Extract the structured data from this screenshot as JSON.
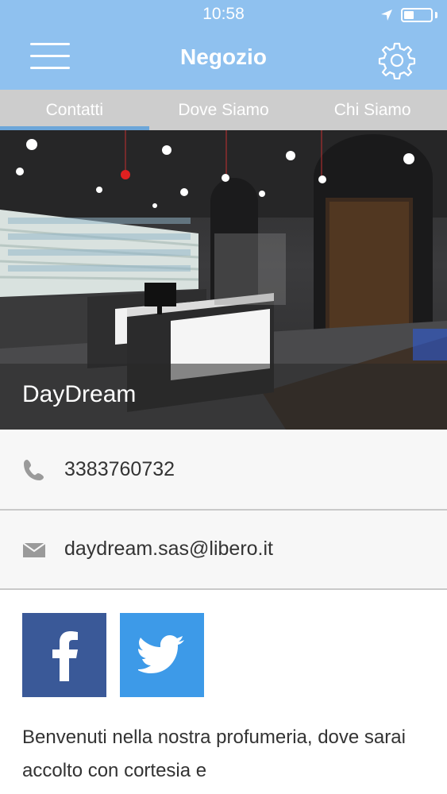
{
  "status_bar": {
    "time": "10:58"
  },
  "header": {
    "title": "Negozio"
  },
  "tabs": [
    {
      "label": "Contatti"
    },
    {
      "label": "Dove Siamo"
    },
    {
      "label": "Chi Siamo"
    }
  ],
  "hero": {
    "caption": "DayDream"
  },
  "contacts": {
    "phone": "3383760732",
    "email": "daydream.sas@libero.it"
  },
  "social": {
    "facebook": "facebook-icon",
    "twitter": "twitter-icon"
  },
  "description": "Benvenuti nella nostra profumeria, dove sarai accolto con cortesia e",
  "colors": {
    "header": "#8fc1ef",
    "tab_bar": "#cdcdcd",
    "tab_indicator": "#6ca6d9",
    "facebook": "#3a5998",
    "twitter": "#3d9ae8"
  }
}
